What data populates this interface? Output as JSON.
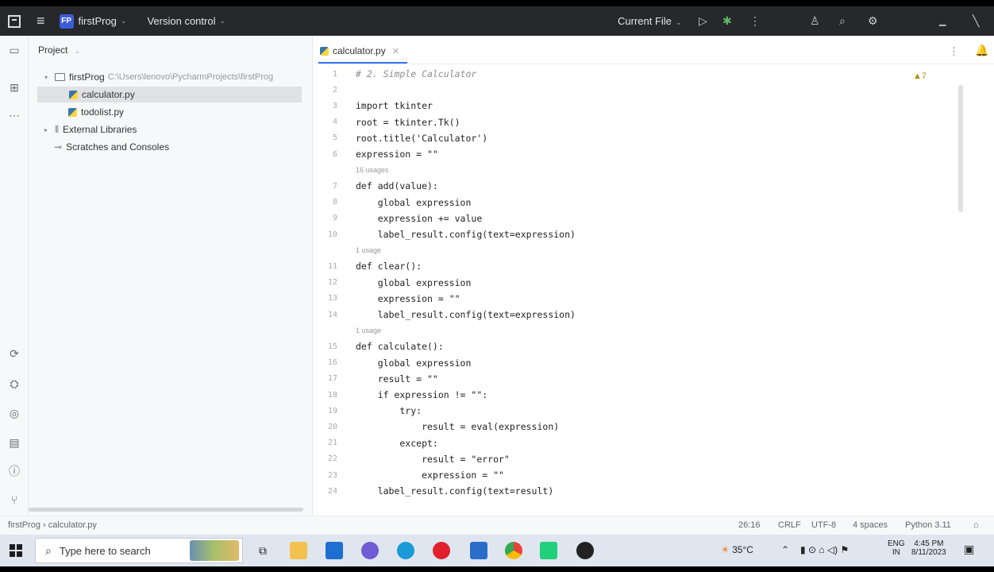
{
  "topbar": {
    "project_badge": "FP",
    "project_name": "firstProg",
    "version_control": "Version control",
    "run_config": "Current File"
  },
  "project_panel": {
    "header": "Project",
    "tree": [
      {
        "label": "firstProg",
        "path": "C:\\Users\\lenovo\\PycharmProjects\\firstProg"
      },
      {
        "label": "calculator.py"
      },
      {
        "label": "todolist.py"
      },
      {
        "label": "External Libraries"
      },
      {
        "label": "Scratches and Consoles"
      }
    ]
  },
  "editor": {
    "tab_label": "calculator.py",
    "warnings": "▲7",
    "lines": [
      {
        "n": "1",
        "text": "# 2. Simple Calculator",
        "cls": "cm"
      },
      {
        "n": "2",
        "text": ""
      },
      {
        "n": "3",
        "text": "import tkinter"
      },
      {
        "n": "4",
        "text": "root = tkinter.Tk()"
      },
      {
        "n": "5",
        "text": "root.title('Calculator')"
      },
      {
        "n": "6",
        "text": "expression = \"\""
      },
      {
        "hint": "16 usages"
      },
      {
        "n": "7",
        "text": "def add(value):"
      },
      {
        "n": "8",
        "text": "    global expression"
      },
      {
        "n": "9",
        "text": "    expression += value"
      },
      {
        "n": "10",
        "text": "    label_result.config(text=expression)"
      },
      {
        "hint": "1 usage"
      },
      {
        "n": "11",
        "text": "def clear():"
      },
      {
        "n": "12",
        "text": "    global expression"
      },
      {
        "n": "13",
        "text": "    expression = \"\""
      },
      {
        "n": "14",
        "text": "    label_result.config(text=expression)"
      },
      {
        "hint": "1 usage"
      },
      {
        "n": "15",
        "text": "def calculate():"
      },
      {
        "n": "16",
        "text": "    global expression"
      },
      {
        "n": "17",
        "text": "    result = \"\""
      },
      {
        "n": "18",
        "text": "    if expression != \"\":"
      },
      {
        "n": "19",
        "text": "        try:"
      },
      {
        "n": "20",
        "text": "            result = eval(expression)"
      },
      {
        "n": "21",
        "text": "        except:"
      },
      {
        "n": "22",
        "text": "            result = \"error\""
      },
      {
        "n": "23",
        "text": "            expression = \"\""
      },
      {
        "n": "24",
        "text": "    label_result.config(text=result)"
      }
    ]
  },
  "statusbar": {
    "breadcrumb_project": "firstProg",
    "breadcrumb_file": "calculator.py",
    "position": "26:16",
    "line_sep": "CRLF",
    "encoding": "UTF-8",
    "indent": "4 spaces",
    "interpreter": "Python 3.11"
  },
  "taskbar": {
    "search_placeholder": "Type here to search",
    "weather": "35°C",
    "lang_line1": "ENG",
    "lang_line2": "IN",
    "time": "4:45 PM",
    "date": "8/11/2023"
  }
}
